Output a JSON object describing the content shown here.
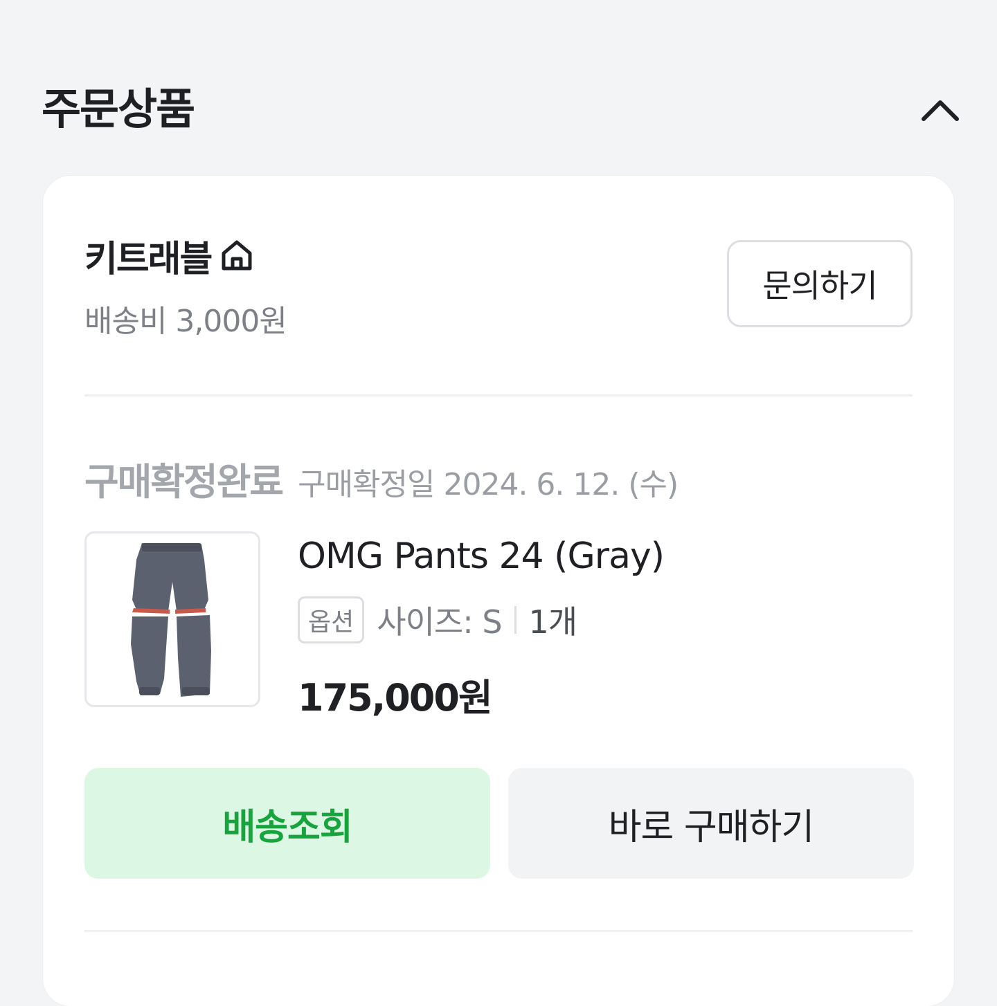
{
  "section": {
    "title": "주문상품",
    "collapse_icon": "chevron-up-icon"
  },
  "seller": {
    "name": "키트래블",
    "home_icon": "home-icon",
    "shipping_fee": "배송비 3,000원",
    "inquiry_label": "문의하기"
  },
  "order": {
    "status": "구매확정완료",
    "confirm_date": "구매확정일 2024. 6. 12. (수)"
  },
  "product": {
    "name": "OMG Pants 24 (Gray)",
    "option_badge": "옵션",
    "option_value": "사이즈: S",
    "quantity": "1개",
    "price": "175,000원",
    "image_icon": "gray-convertible-pants-image"
  },
  "actions": {
    "track_label": "배송조회",
    "buy_again_label": "바로 구매하기"
  },
  "colors": {
    "accent_green": "#18a43d",
    "accent_green_bg": "#dcf7e3",
    "muted_text": "#7d8087"
  }
}
